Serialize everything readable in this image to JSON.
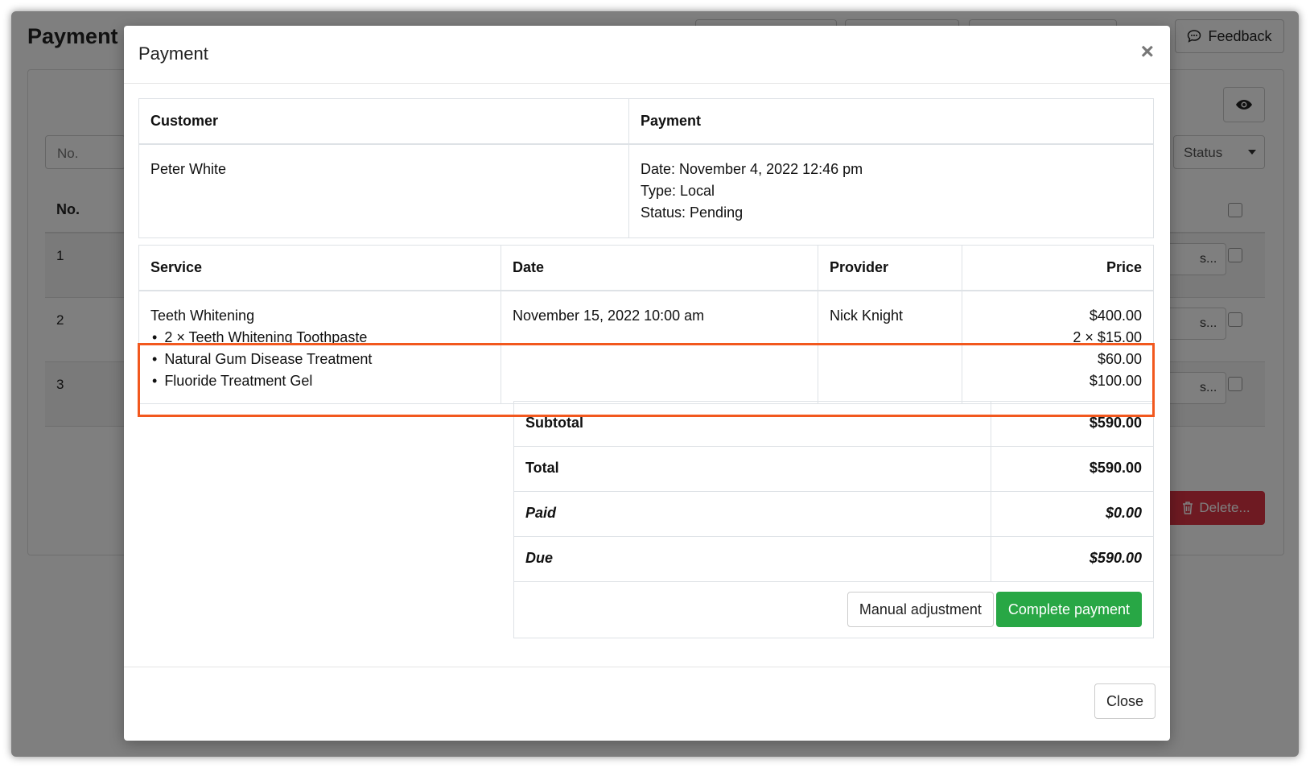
{
  "background": {
    "page_title": "Payment",
    "feedback_label": "Feedback",
    "filter_no_placeholder": "No.",
    "status_filter": "Status",
    "table_header_no": "No.",
    "rows": [
      {
        "no": "1",
        "action": "s..."
      },
      {
        "no": "2",
        "action": "s..."
      },
      {
        "no": "3",
        "action": "s..."
      }
    ],
    "delete_label": "Delete..."
  },
  "modal": {
    "title": "Payment",
    "close_glyph": "×",
    "info": {
      "customer_header": "Customer",
      "payment_header": "Payment",
      "customer_name": "Peter White",
      "payment_date": "Date: November 4, 2022 12:46 pm",
      "payment_type": "Type: Local",
      "payment_status": "Status: Pending"
    },
    "services": {
      "headers": {
        "service": "Service",
        "date": "Date",
        "provider": "Provider",
        "price": "Price"
      },
      "row": {
        "service": "Teeth Whitening",
        "date": "November 15, 2022 10:00 am",
        "provider": "Nick Knight",
        "price": "$400.00",
        "extras": [
          {
            "name": "2 × Teeth Whitening Toothpaste",
            "price": "2 × $15.00"
          },
          {
            "name": "Natural Gum Disease Treatment",
            "price": "$60.00"
          },
          {
            "name": "Fluoride Treatment Gel",
            "price": "$100.00"
          }
        ]
      }
    },
    "totals": {
      "subtotal_label": "Subtotal",
      "subtotal": "$590.00",
      "total_label": "Total",
      "total": "$590.00",
      "paid_label": "Paid",
      "paid": "$0.00",
      "due_label": "Due",
      "due": "$590.00"
    },
    "buttons": {
      "manual_adjustment": "Manual adjustment",
      "complete_payment": "Complete payment",
      "close": "Close"
    }
  },
  "colors": {
    "highlight": "#f2581e",
    "success": "#28a745",
    "danger": "#dc3545"
  }
}
